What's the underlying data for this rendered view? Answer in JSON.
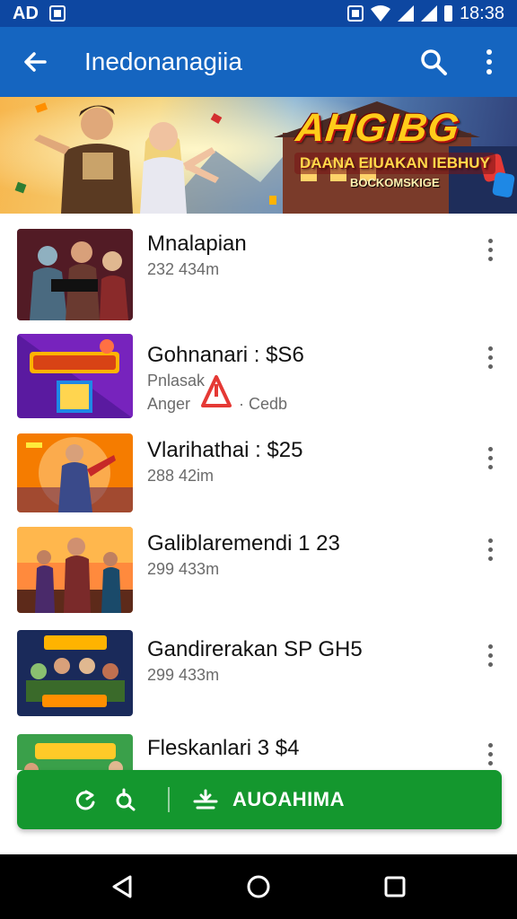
{
  "status_bar": {
    "left_text": "AD",
    "time": "18:38",
    "icons": [
      "notification-icon",
      "nfc-icon",
      "wifi-icon",
      "signal-icon",
      "signal-icon",
      "battery-icon"
    ]
  },
  "app_bar": {
    "title": "Inedonanagiia",
    "icons": [
      "back-arrow-icon",
      "search-icon",
      "more-vert-icon"
    ]
  },
  "banner": {
    "title": "AHGIBG",
    "subtitle": "DAANA EIUAKAN IEBHUY",
    "tagline": "BOCKOMSKIGE"
  },
  "list": {
    "items": [
      {
        "title": "Mnalapian",
        "meta": "232 434m",
        "thumb_theme": "dark-heroes"
      },
      {
        "title": "Gohnanari : $S6",
        "meta_line1": "Pnlasak",
        "meta_line2": "Anger",
        "meta_suffix": "· Cedb",
        "warning_icon": "warning-triangle-icon",
        "thumb_theme": "purple-arcade"
      },
      {
        "title": "Vlarihathai : $25",
        "meta": "288 42im",
        "thumb_theme": "orange-hero"
      },
      {
        "title": "Galiblaremendi 1 23",
        "meta": "299 433m",
        "thumb_theme": "sunset-team"
      },
      {
        "title": "Gandirerakan SP GH5",
        "meta": "299 433m",
        "thumb_theme": "blue-crowd"
      },
      {
        "title": "Fleskanlari 3 $4",
        "meta": "",
        "thumb_theme": "green-party"
      }
    ]
  },
  "action_bar": {
    "label": "AUOAHIMA",
    "icons": [
      "refresh-icon",
      "sync-icon",
      "install-icon"
    ],
    "color": "#14972e"
  },
  "nav_bar": {
    "icons": [
      "back-triangle-icon",
      "home-circle-icon",
      "recents-square-icon"
    ]
  },
  "colors": {
    "app_bar": "#1565c0",
    "status_bar": "#0d47a1",
    "accent_green": "#14972e"
  }
}
